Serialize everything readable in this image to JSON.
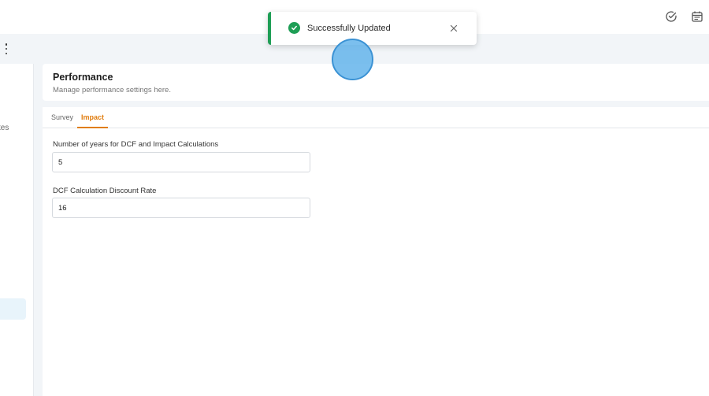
{
  "header": {
    "icons": [
      "check-circle-icon",
      "calendar-icon"
    ]
  },
  "sidebar": {
    "partial_text": "tes"
  },
  "page": {
    "title": "Performance",
    "subtitle": "Manage performance settings here."
  },
  "tabs": [
    {
      "label": "Survey",
      "active": false
    },
    {
      "label": "Impact",
      "active": true
    }
  ],
  "form": {
    "years_label": "Number of years for DCF and Impact Calculations",
    "years_value": "5",
    "rate_label": "DCF Calculation Discount Rate",
    "rate_value": "16"
  },
  "toast": {
    "message": "Successfully Updated",
    "status_color": "#1e9e55"
  },
  "colors": {
    "accent": "#e07d10",
    "success": "#1e9e55"
  }
}
